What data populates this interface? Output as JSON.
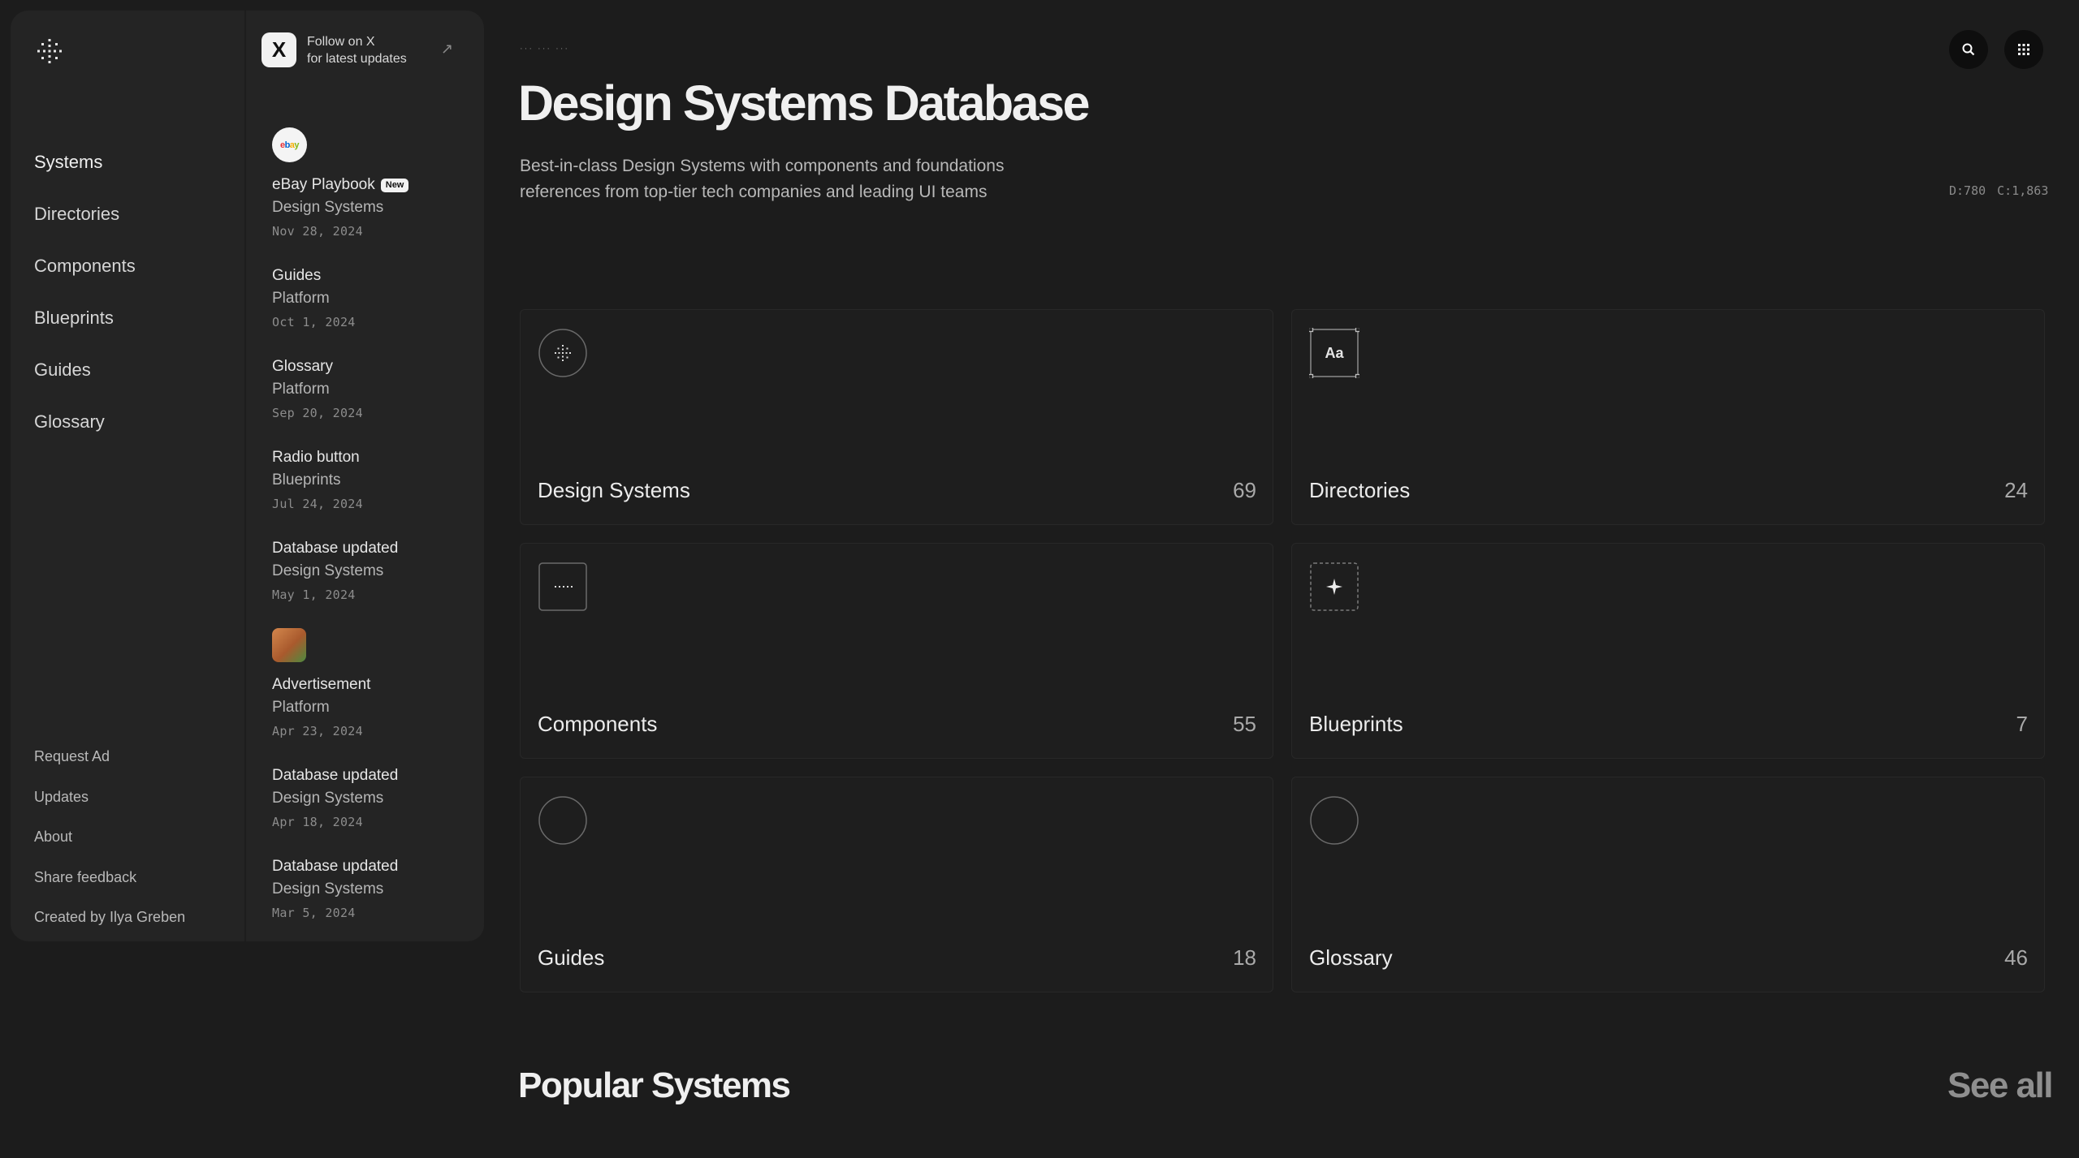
{
  "sidebar": {
    "nav": [
      "Systems",
      "Directories",
      "Components",
      "Blueprints",
      "Guides",
      "Glossary"
    ],
    "footer": [
      "Request Ad",
      "Updates",
      "About",
      "Share feedback",
      "Created by Ilya Greben"
    ]
  },
  "follow": {
    "line1": "Follow on X",
    "line2": "for latest updates",
    "x_glyph": "X"
  },
  "feed": [
    {
      "thumb": "ebay",
      "title": "eBay Playbook",
      "badge": "New",
      "category": "Design Systems",
      "date": "Nov 28, 2024"
    },
    {
      "title": "Guides",
      "category": "Platform",
      "date": "Oct 1, 2024"
    },
    {
      "title": "Glossary",
      "category": "Platform",
      "date": "Sep 20, 2024"
    },
    {
      "title": "Radio button",
      "category": "Blueprints",
      "date": "Jul 24, 2024"
    },
    {
      "title": "Database updated",
      "category": "Design Systems",
      "date": "May 1, 2024"
    },
    {
      "thumb": "ad",
      "title": "Advertisement",
      "category": "Platform",
      "date": "Apr 23, 2024"
    },
    {
      "title": "Database updated",
      "category": "Design Systems",
      "date": "Apr 18, 2024"
    },
    {
      "title": "Database updated",
      "category": "Design Systems",
      "date": "Mar 5, 2024"
    }
  ],
  "header": {
    "breadcrumb": "··· ··· ···",
    "title": "Design Systems Database",
    "subtitle_line1": "Best-in-class Design Systems with components and foundations",
    "subtitle_line2": "references from top-tier tech companies and leading UI teams",
    "stat_d": "D:780",
    "stat_c": "C:1,863"
  },
  "cards": [
    {
      "label": "Design Systems",
      "count": "69",
      "icon": "sparkle-circle-icon"
    },
    {
      "label": "Directories",
      "count": "24",
      "icon": "text-frame-icon",
      "icon_text": "Aa"
    },
    {
      "label": "Components",
      "count": "55",
      "icon": "dots-box-icon"
    },
    {
      "label": "Blueprints",
      "count": "7",
      "icon": "star-dashed-box-icon"
    },
    {
      "label": "Guides",
      "count": "18",
      "icon": "circle-icon"
    },
    {
      "label": "Glossary",
      "count": "46",
      "icon": "circle-icon"
    }
  ],
  "popular": {
    "title": "Popular Systems",
    "see_all": "See all"
  },
  "colors": {
    "background": "#1c1c1c",
    "panel": "#242424",
    "card": "#1e1e1e",
    "text": "#e8e8e8",
    "muted": "#8a8a8a"
  }
}
